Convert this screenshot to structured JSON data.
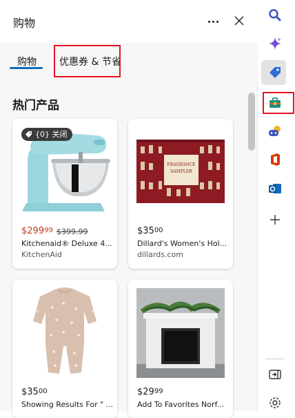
{
  "pane": {
    "title": "购物",
    "tabs": [
      {
        "label": "购物",
        "active": true
      },
      {
        "label": "优惠券 & 节省",
        "active": false
      }
    ],
    "section_title": "热门产品"
  },
  "products": [
    {
      "badge": "{0} 关闭",
      "price_whole": "$299",
      "price_cents": "99",
      "old_price": "$399.99",
      "name": "Kitchenaid® Deluxe 4...",
      "source": "KitchenAid",
      "on_sale": true
    },
    {
      "price_whole": "$35",
      "price_cents": "00",
      "name": "Dillard's Women's Hol...",
      "source": "dillards.com",
      "image_text_1": "FRAGRANCE",
      "image_text_2": "SAMPLER"
    },
    {
      "price_whole": "$35",
      "price_cents": "00",
      "name": "Showing Results For \" ..."
    },
    {
      "price_whole": "$29",
      "price_cents": "99",
      "name": "Add To Favorites Norf..."
    }
  ],
  "colors": {
    "accent": "#0f6cbd",
    "sale_price": "#c0391b",
    "highlight_box": "#e81123"
  },
  "sidebar": {
    "icons": [
      "search-icon",
      "copilot-sparkle-icon",
      "shopping-tag-icon",
      "tools-briefcase-icon",
      "games-icon",
      "office-icon",
      "outlook-icon",
      "add-icon",
      "split-screen-icon",
      "settings-icon"
    ]
  }
}
